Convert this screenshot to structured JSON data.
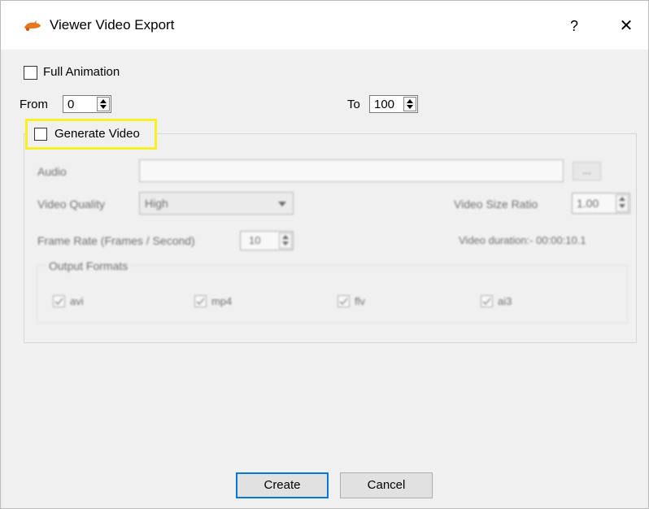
{
  "window": {
    "title": "Viewer Video Export",
    "help": "?",
    "close": "✕"
  },
  "full_animation": {
    "label": "Full Animation",
    "checked": false
  },
  "range": {
    "from_label": "From",
    "from_value": "0",
    "to_label": "To",
    "to_value": "100"
  },
  "generate_video": {
    "label": "Generate Video",
    "checked": false,
    "highlight_color": "#f5f224"
  },
  "audio": {
    "label": "Audio",
    "value": "",
    "browse_label": "..."
  },
  "video_quality": {
    "label": "Video Quality",
    "value": "High"
  },
  "video_size_ratio": {
    "label": "Video Size Ratio",
    "value": "1.00"
  },
  "frame_rate": {
    "label": "Frame Rate (Frames / Second)",
    "value": "10"
  },
  "video_duration": {
    "text": "Video duration:- 00:00:10.1"
  },
  "output_formats": {
    "title": "Output Formats",
    "items": [
      {
        "label": "avi",
        "checked": true
      },
      {
        "label": "mp4",
        "checked": true
      },
      {
        "label": "flv",
        "checked": true
      },
      {
        "label": "ai3",
        "checked": true
      }
    ]
  },
  "buttons": {
    "create": "Create",
    "cancel": "Cancel"
  },
  "colors": {
    "accent": "#0078d7",
    "app_icon": "#e8761e"
  }
}
